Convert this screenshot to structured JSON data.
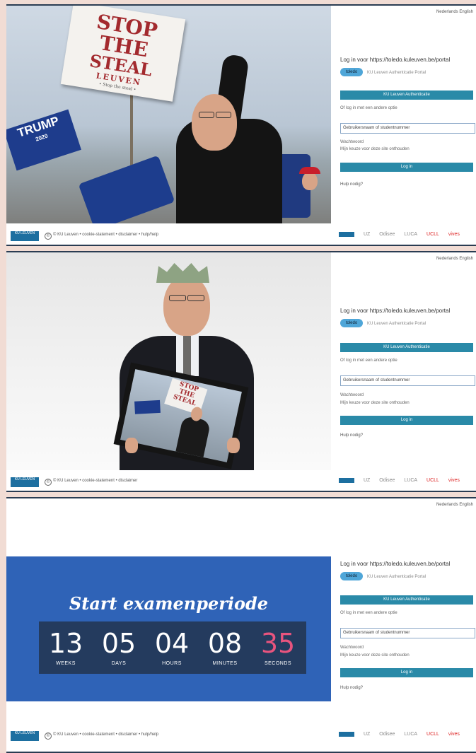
{
  "panels": [
    {
      "sign": {
        "line1": "STOP",
        "line2": "THE",
        "line3": "STEAL",
        "line4": "LEUVEN",
        "line5": "• Stop the steal •"
      },
      "flag": {
        "text": "TRUMP",
        "sub": "2020"
      },
      "footer": {
        "logo": "KU LEUVEN",
        "text": "© KU Leuven  • cookie-statement  • disclaimer  • hulp/help"
      },
      "login": {
        "lang": "Nederlands  English",
        "title": "Log in voor https://toledo.kuleuven.be/portal",
        "logo": "toledo",
        "subtitle": "KU Leuven Authenticatie Portal",
        "auth_button": "KU Leuven Authenticatie",
        "alt_link": "Of log in met een andere optie",
        "user_field": "Gebruikersnaam of studentnummer",
        "pw_label": "Wachtwoord",
        "remember": "Mijn keuze voor deze site onthouden",
        "login_button": "Log in",
        "help": "Hulp nodig?"
      },
      "brands": [
        "KU LEUVEN",
        "UZ",
        "Odisee",
        "LUCA",
        "UCLL",
        "vives"
      ]
    },
    {
      "frame_sign": {
        "line1": "STOP",
        "line2": "THE",
        "line3": "STEAL"
      },
      "footer": {
        "logo": "KU LEUVEN",
        "text": "© KU Leuven  • cookie-statement  • disclaimer"
      },
      "login": {
        "lang": "Nederlands  English",
        "title": "Log in voor https://toledo.kuleuven.be/portal",
        "logo": "toledo",
        "subtitle": "KU Leuven Authenticatie Portal",
        "auth_button": "KU Leuven Authenticatie",
        "alt_link": "Of log in met een andere optie",
        "user_field": "Gebruikersnaam of studentnummer",
        "pw_label": "Wachtwoord",
        "remember": "Mijn keuze voor deze site onthouden",
        "login_button": "Log in",
        "help": "Hulp nodig?"
      },
      "brands": [
        "KU LEUVEN",
        "UZ",
        "Odisee",
        "LUCA",
        "UCLL",
        "vives"
      ]
    },
    {
      "countdown": {
        "title": "Start examenperiode",
        "units": [
          {
            "value": "13",
            "label": "WEEKS"
          },
          {
            "value": "05",
            "label": "DAYS"
          },
          {
            "value": "04",
            "label": "HOURS"
          },
          {
            "value": "08",
            "label": "MINUTES"
          },
          {
            "value": "35",
            "label": "SECONDS"
          }
        ]
      },
      "footer": {
        "logo": "KU LEUVEN",
        "text": "© KU Leuven  • cookie-statement  • disclaimer  • hulp/help"
      },
      "login": {
        "lang": "Nederlands  English",
        "title": "Log in voor https://toledo.kuleuven.be/portal",
        "logo": "toledo",
        "subtitle": "KU Leuven Authenticatie Portal",
        "auth_button": "KU Leuven Authenticatie",
        "alt_link": "Of log in met een andere optie",
        "user_field": "Gebruikersnaam of studentnummer",
        "pw_label": "Wachtwoord",
        "remember": "Mijn keuze voor deze site onthouden",
        "login_button": "Log in",
        "help": "Hulp nodig?"
      },
      "brands": [
        "KU LEUVEN",
        "UZ",
        "Odisee",
        "LUCA",
        "UCLL",
        "vives"
      ]
    }
  ]
}
